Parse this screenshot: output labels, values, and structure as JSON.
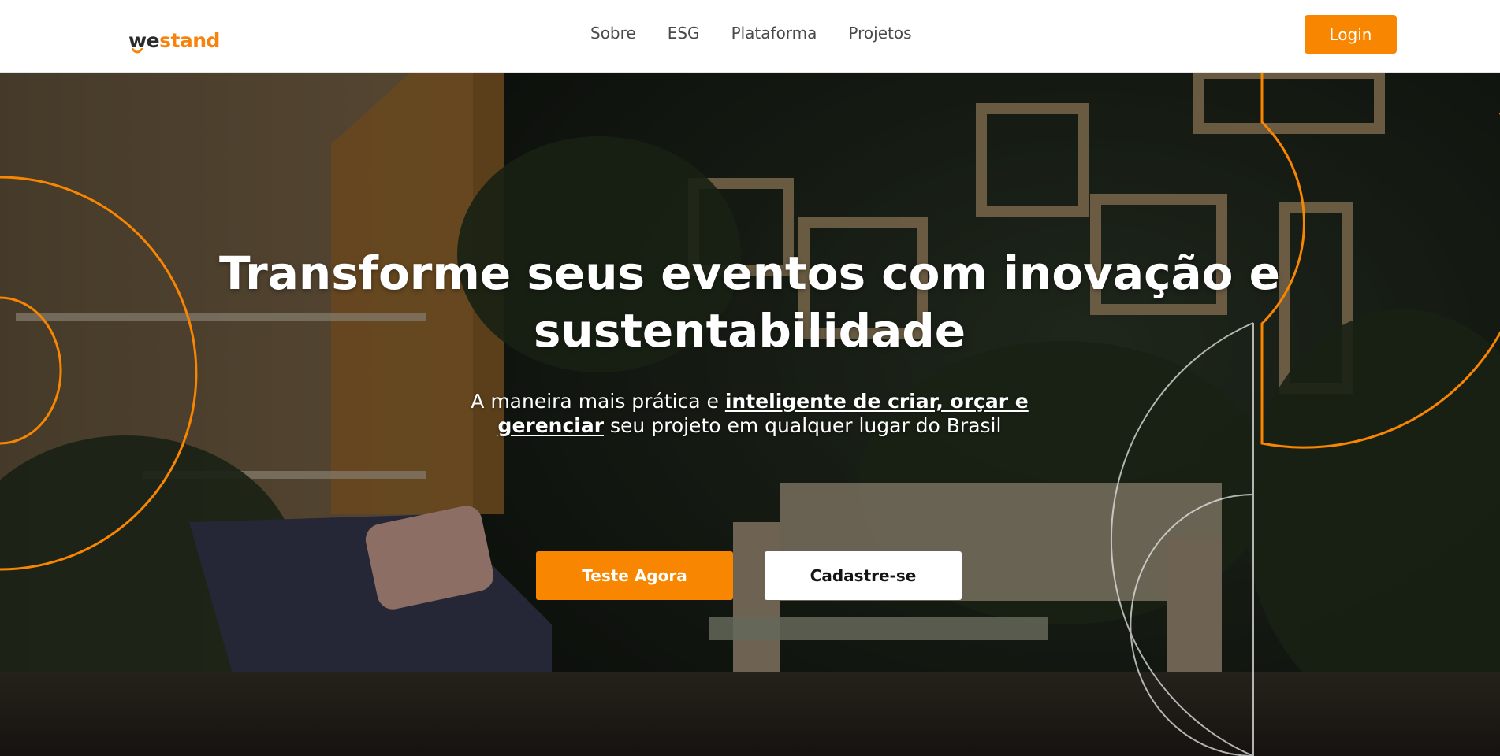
{
  "brand": {
    "logo_part1": "we",
    "logo_part2": "stand",
    "accent_color": "#f98600",
    "dark_text_color": "#2b2b2b"
  },
  "nav": {
    "links": [
      {
        "label": "Sobre"
      },
      {
        "label": "ESG"
      },
      {
        "label": "Plataforma"
      },
      {
        "label": "Projetos"
      }
    ],
    "login_label": "Login"
  },
  "hero": {
    "title_line1": "Transforme seus eventos com inovação e",
    "title_line2": "sustentabilidade",
    "subtitle": {
      "part1": "A maneira mais prática e ",
      "emphasis": "inteligente de criar, orçar e gerenciar",
      "part2": " seu projeto em qualquer lugar do Brasil"
    },
    "primary_cta": "Teste Agora",
    "secondary_cta": "Cadastre-se",
    "background_image": "event-stand-with-plants-photo",
    "decoration_color": "#f98600"
  }
}
